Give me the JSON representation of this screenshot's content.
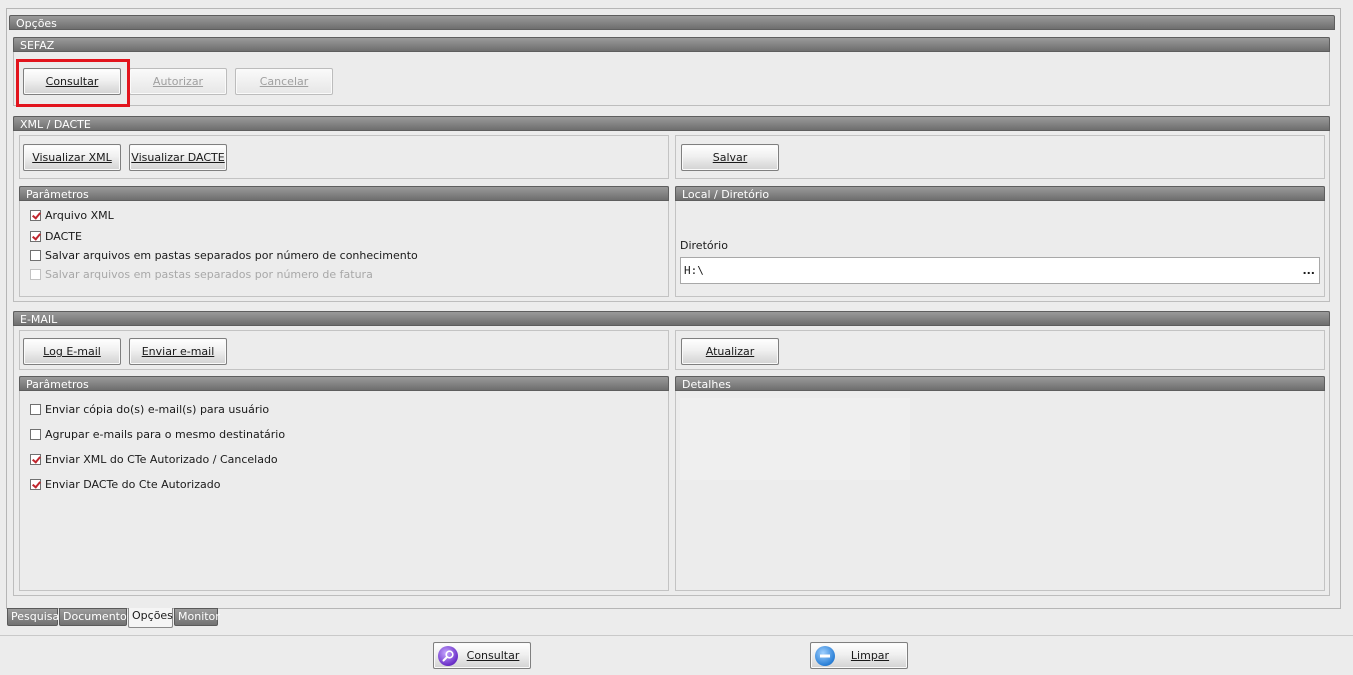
{
  "window": {
    "title": "Opções"
  },
  "sefaz": {
    "title": "SEFAZ",
    "consultar": "Consultar",
    "autorizar": "Autorizar",
    "cancelar": "Cancelar"
  },
  "xml": {
    "title": "XML / DACTE",
    "visualizar_xml": "Visualizar XML",
    "visualizar_dacte": "Visualizar DACTE",
    "salvar": "Salvar",
    "parametros_title": "Parâmetros",
    "params": [
      {
        "label": "Arquivo XML",
        "checked": true,
        "enabled": true
      },
      {
        "label": "DACTE",
        "checked": true,
        "enabled": true
      },
      {
        "label": "Salvar arquivos em pastas separados por número de conhecimento",
        "checked": false,
        "enabled": true
      },
      {
        "label": "Salvar arquivos em pastas separados por número de fatura",
        "checked": false,
        "enabled": false
      }
    ],
    "local_title": "Local / Diretório",
    "diretorio_label": "Diretório",
    "diretorio_value": "H:\\",
    "browse_label": "..."
  },
  "email": {
    "title": "E-MAIL",
    "log_email": "Log E-mail",
    "enviar_email": "Enviar e-mail",
    "atualizar": "Atualizar",
    "parametros_title": "Parâmetros",
    "params": [
      {
        "label": "Enviar cópia do(s) e-mail(s) para usuário",
        "checked": false
      },
      {
        "label": "Agrupar e-mails para o mesmo destinatário",
        "checked": false
      },
      {
        "label": "Enviar XML do CTe Autorizado / Cancelado",
        "checked": true
      },
      {
        "label": "Enviar DACTe do Cte Autorizado",
        "checked": true
      }
    ],
    "detalhes_title": "Detalhes"
  },
  "tabs": [
    "Pesquisa",
    "Documentos",
    "Opções",
    "Monitor"
  ],
  "active_tab": "Opções",
  "bottom": {
    "consultar": "Consultar",
    "limpar": "Limpar"
  },
  "colors": {
    "highlight": "#e2141d",
    "check": "#c0262e",
    "header": "#7f7f7f"
  }
}
